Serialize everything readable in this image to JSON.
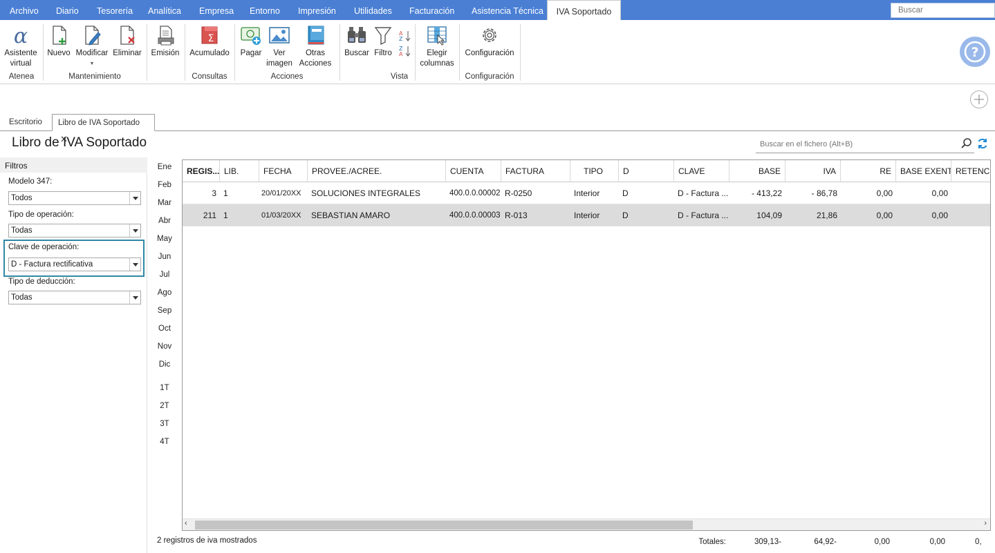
{
  "menu": {
    "items": [
      "Archivo",
      "Diario",
      "Tesorería",
      "Analítica",
      "Empresa",
      "Entorno",
      "Impresión",
      "Utilidades",
      "Facturación",
      "Asistencia Técnica"
    ],
    "active": "IVA Soportado",
    "search_placeholder": "Buscar"
  },
  "ribbon": {
    "asistente": "Asistente virtual",
    "nuevo": "Nuevo",
    "modificar": "Modificar",
    "eliminar": "Eliminar",
    "emision": "Emisión",
    "acumulado": "Acumulado",
    "pagar": "Pagar",
    "ver_imagen": "Ver imagen",
    "otras_acciones": "Otras Acciones",
    "buscar": "Buscar",
    "filtro": "Filtro",
    "elegir_columnas": "Elegir columnas",
    "configuracion": "Configuración",
    "groups": [
      "Atenea",
      "Mantenimiento",
      "Consultas",
      "Acciones",
      "Vista",
      "Configuración"
    ]
  },
  "tabs": [
    "Escritorio",
    "Libro de IVA Soportado"
  ],
  "page": {
    "title": "Libro de IVA Soportado",
    "search_placeholder": "Buscar en el fichero (Alt+B)"
  },
  "filters": {
    "header": "Filtros",
    "modelo_label": "Modelo 347:",
    "modelo_value": "Todos",
    "tipo_op_label": "Tipo de operación:",
    "tipo_op_value": "Todas",
    "clave_label": "Clave de operación:",
    "clave_value": "D - Factura rectificativa",
    "tipo_ded_label": "Tipo de deducción:",
    "tipo_ded_value": "Todas"
  },
  "months": [
    "Ene",
    "Feb",
    "Mar",
    "Abr",
    "May",
    "Jun",
    "Jul",
    "Ago",
    "Sep",
    "Oct",
    "Nov",
    "Dic"
  ],
  "quarters": [
    "1T",
    "2T",
    "3T",
    "4T"
  ],
  "grid": {
    "columns": [
      "REGIS...",
      "LIB.",
      "FECHA",
      "PROVEE./ACREE.",
      "CUENTA",
      "FACTURA",
      "TIPO",
      "D",
      "CLAVE",
      "BASE",
      "IVA",
      "RE",
      "BASE EXENTA",
      "RETENCI"
    ],
    "rows": [
      [
        "3",
        "1",
        "20/01/20XX",
        "SOLUCIONES INTEGRALES",
        "400.0.0.00002",
        "R-0250",
        "Interior",
        "D",
        "D - Factura ...",
        "- 413,22",
        "- 86,78",
        "0,00",
        "0,00"
      ],
      [
        "211",
        "1",
        "01/03/20XX",
        "SEBASTIAN AMARO",
        "400.0.0.00003",
        "R-013",
        "Interior",
        "D",
        "D - Factura ...",
        "104,09",
        "21,86",
        "0,00",
        "0,00"
      ]
    ]
  },
  "status": {
    "count_text": "2 registros de iva mostrados",
    "totales_label": "Totales:",
    "totals": [
      "309,13-",
      "64,92-",
      "0,00",
      "0,00",
      "0,"
    ]
  },
  "colors": {
    "menubar": "#4a7fd4",
    "accent": "#2f87a6",
    "selected_row": "#dcdcdc"
  }
}
